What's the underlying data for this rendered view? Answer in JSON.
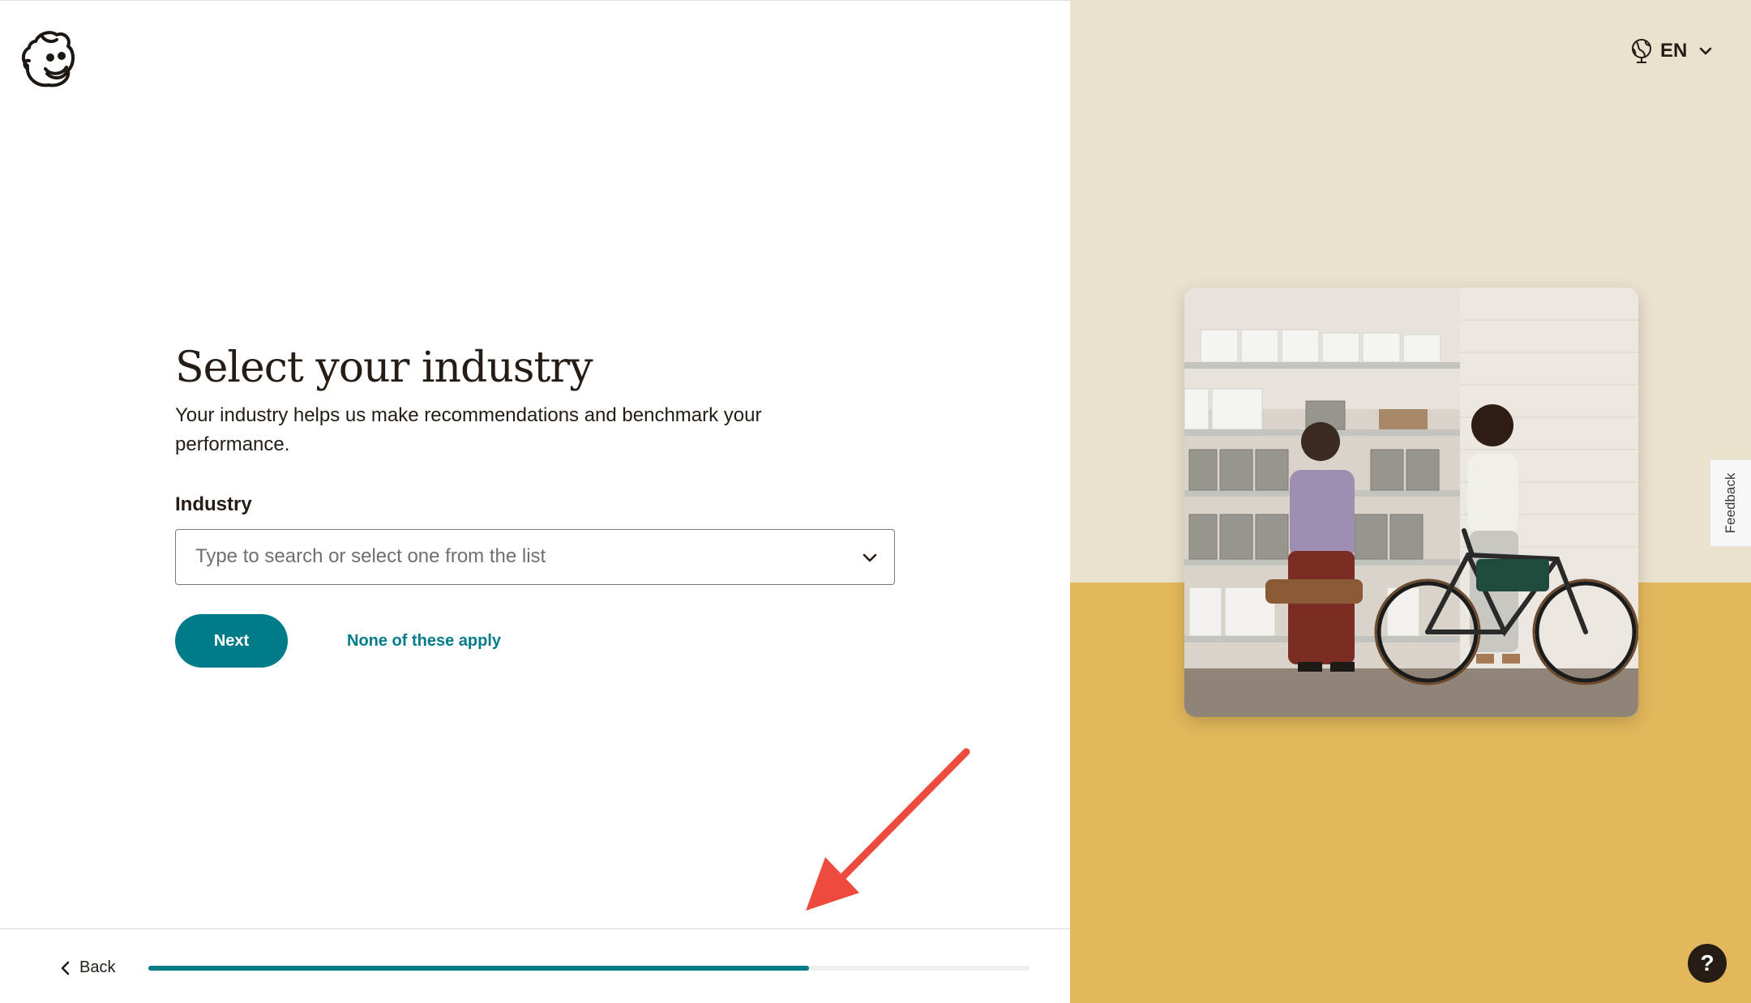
{
  "brand": {
    "logo_icon": "mailchimp-freddie-icon"
  },
  "form": {
    "title": "Select your industry",
    "subtitle": "Your industry helps us make recommendations and benchmark your performance.",
    "field_label": "Industry",
    "placeholder": "Type to search or select one from the list",
    "value": "",
    "next_label": "Next",
    "none_label": "None of these apply"
  },
  "footer": {
    "back_label": "Back",
    "progress_percent": 75
  },
  "sidebar": {
    "language": "EN",
    "feedback_label": "Feedback",
    "help_label": "?"
  },
  "colors": {
    "accent": "#007c89",
    "cream": "#ebe2ce",
    "yellow": "#e3b85c",
    "annotation_arrow": "#ee4b3f"
  }
}
